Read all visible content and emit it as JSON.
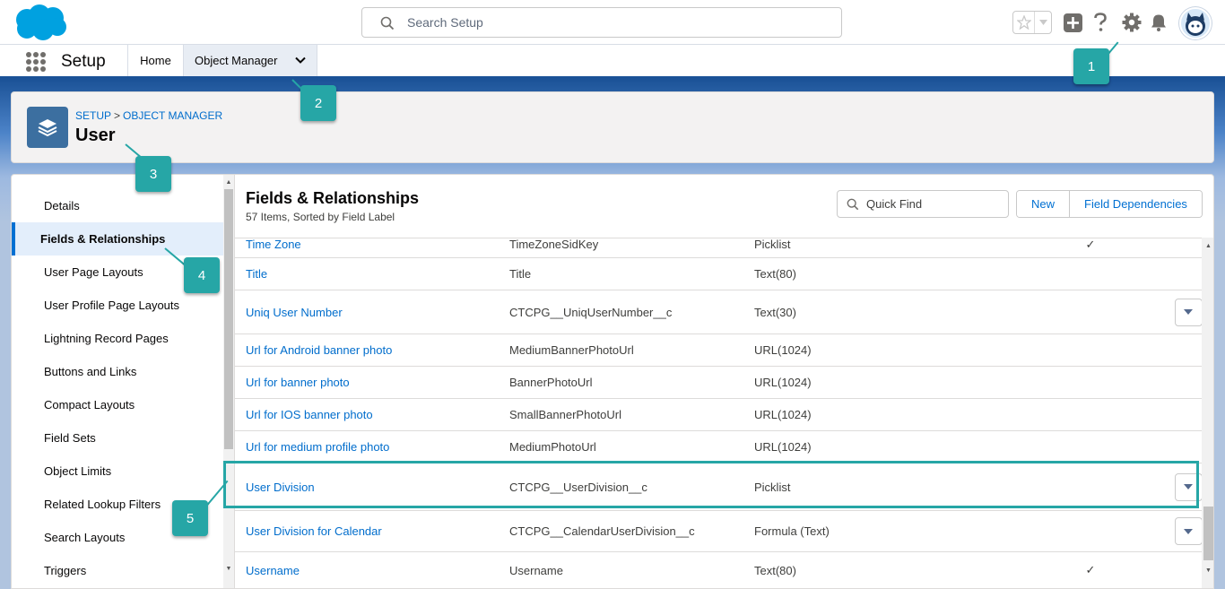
{
  "header": {
    "search_placeholder": "Search Setup"
  },
  "nav": {
    "app_name": "Setup",
    "tabs": [
      {
        "label": "Home"
      },
      {
        "label": "Object Manager"
      }
    ]
  },
  "object": {
    "breadcrumb_setup": "SETUP",
    "breadcrumb_sep": ">",
    "breadcrumb_om": "OBJECT MANAGER",
    "title": "User"
  },
  "sidebar": {
    "items": [
      {
        "label": "Details"
      },
      {
        "label": "Fields & Relationships",
        "active": true
      },
      {
        "label": "User Page Layouts"
      },
      {
        "label": "User Profile Page Layouts"
      },
      {
        "label": "Lightning Record Pages"
      },
      {
        "label": "Buttons and Links"
      },
      {
        "label": "Compact Layouts"
      },
      {
        "label": "Field Sets"
      },
      {
        "label": "Object Limits"
      },
      {
        "label": "Related Lookup Filters"
      },
      {
        "label": "Search Layouts"
      },
      {
        "label": "Triggers"
      }
    ]
  },
  "content": {
    "title": "Fields & Relationships",
    "subtitle": "57 Items, Sorted by Field Label",
    "quick_find_placeholder": "Quick Find",
    "new_label": "New",
    "field_dependencies_label": "Field Dependencies"
  },
  "rows": [
    {
      "label": "Time Zone",
      "api": "TimeZoneSidKey",
      "type": "Picklist",
      "indexed": "✓",
      "menu": false
    },
    {
      "label": "Title",
      "api": "Title",
      "type": "Text(80)",
      "indexed": "",
      "menu": false
    },
    {
      "label": "Uniq User Number",
      "api": "CTCPG__UniqUserNumber__c",
      "type": "Text(30)",
      "indexed": "",
      "menu": true
    },
    {
      "label": "Url for Android banner photo",
      "api": "MediumBannerPhotoUrl",
      "type": "URL(1024)",
      "indexed": "",
      "menu": false
    },
    {
      "label": "Url for banner photo",
      "api": "BannerPhotoUrl",
      "type": "URL(1024)",
      "indexed": "",
      "menu": false
    },
    {
      "label": "Url for IOS banner photo",
      "api": "SmallBannerPhotoUrl",
      "type": "URL(1024)",
      "indexed": "",
      "menu": false
    },
    {
      "label": "Url for medium profile photo",
      "api": "MediumPhotoUrl",
      "type": "URL(1024)",
      "indexed": "",
      "menu": false
    },
    {
      "label": "User Division",
      "api": "CTCPG__UserDivision__c",
      "type": "Picklist",
      "indexed": "",
      "menu": true
    },
    {
      "label": "User Division for Calendar",
      "api": "CTCPG__CalendarUserDivision__c",
      "type": "Formula (Text)",
      "indexed": "",
      "menu": true
    },
    {
      "label": "Username",
      "api": "Username",
      "type": "Text(80)",
      "indexed": "✓",
      "menu": false
    }
  ],
  "callouts": [
    "1",
    "2",
    "3",
    "4",
    "5"
  ],
  "colors": {
    "accent": "#0070d2",
    "callout": "#26a6a6",
    "nav_border": "#1b5297",
    "object_icon": "#3c6fa0"
  }
}
